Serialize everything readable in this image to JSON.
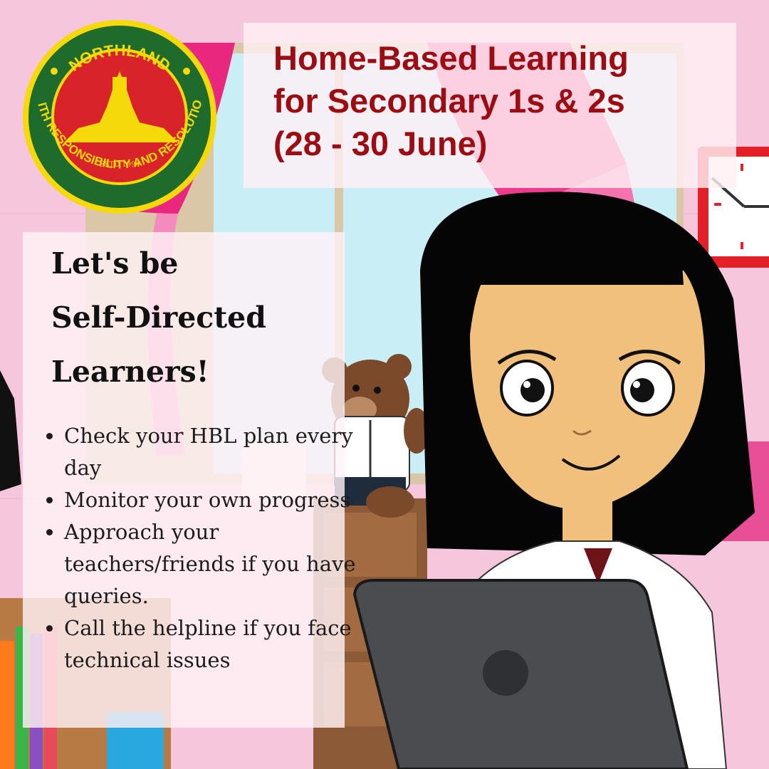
{
  "logo": {
    "school_name": "NORTHLAND",
    "motto": "WITH RESPONSIBILITY AND RESOLUTION",
    "established": "ESTD 1994"
  },
  "title": {
    "line1": "Home-Based Learning",
    "line2": "for Secondary 1s & 2s",
    "line3": "(28 - 30 June)"
  },
  "heading": {
    "line1": "Let's be",
    "line2": "Self-Directed",
    "line3": "Learners!"
  },
  "tips": [
    "Check your HBL plan every day",
    "Monitor your own progress",
    "Approach your teachers/friends if you have queries.",
    "Call the helpline if you face technical issues"
  ],
  "colors": {
    "title_red": "#9b0d12",
    "logo_red": "#d8232a",
    "logo_green": "#1f6b2c",
    "logo_yellow": "#f5d90a",
    "wall_pink": "#f6c6dc"
  }
}
